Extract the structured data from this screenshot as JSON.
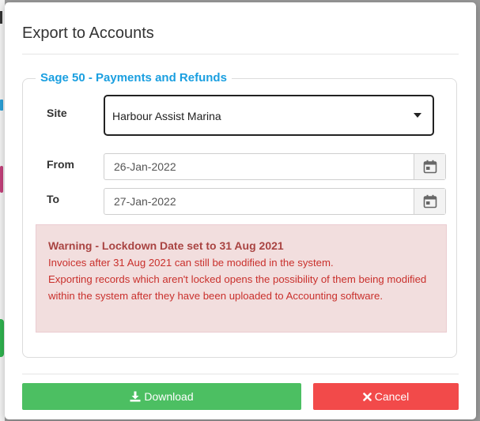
{
  "modal": {
    "title": "Export to Accounts"
  },
  "section": {
    "legend": "Sage 50 - Payments and Refunds"
  },
  "form": {
    "site_label": "Site",
    "site_value": "Harbour Assist Marina",
    "from_label": "From",
    "from_value": "26-Jan-2022",
    "to_label": "To",
    "to_value": "27-Jan-2022"
  },
  "warning": {
    "title": "Warning - Lockdown Date set to 31 Aug 2021",
    "line1": "Invoices after 31 Aug 2021 can still be modified in the system.",
    "line2": "Exporting records which aren't locked opens the possibility of them being modified within the system after they have been uploaded to Accounting software."
  },
  "buttons": {
    "download_label": "Download",
    "cancel_label": "Cancel"
  },
  "icons": {
    "select": "chevron-down-icon",
    "date": "calendar-icon",
    "download": "download-icon",
    "cancel": "close-icon"
  },
  "colors": {
    "legend": "#1a9fe0",
    "download": "#4cbf62",
    "cancel": "#f24a4a",
    "warning_bg": "#f2dede",
    "warning_text": "#c9302c"
  }
}
